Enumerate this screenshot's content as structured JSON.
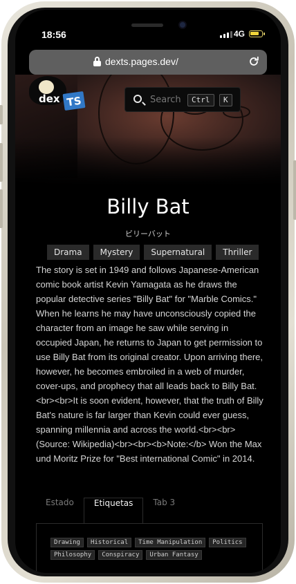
{
  "status_bar": {
    "time": "18:56",
    "network": "4G"
  },
  "browser": {
    "url": "dexts.pages.dev/"
  },
  "site": {
    "logo_text": "dex",
    "logo_badge": "TS",
    "search": {
      "placeholder": "Search",
      "shortcut_ctrl": "Ctrl",
      "shortcut_key": "K"
    }
  },
  "title": {
    "name": "Billy Bat",
    "native_name": "ビリーバット",
    "genres": [
      "Drama",
      "Mystery",
      "Supernatural",
      "Thriller"
    ],
    "description": "The story is set in 1949 and follows Japanese-American comic book artist Kevin Yamagata as he draws the popular detective series \"Billy Bat\" for \"Marble Comics.\" When he learns he may have unconsciously copied the character from an image he saw while serving in occupied Japan, he returns to Japan to get permission to use Billy Bat from its original creator. Upon arriving there, however, he becomes embroiled in a web of murder, cover-ups, and prophecy that all leads back to Billy Bat.<br><br>It is soon evident, however, that the truth of Billy Bat's nature is far larger than Kevin could ever guess, spanning millennia and across the world.<br><br> (Source: Wikipedia)<br><br><b>Note:</b> Won the Max und Moritz Prize for \"Best international Comic\" in 2014."
  },
  "tabs": [
    {
      "label": "Estado",
      "active": false
    },
    {
      "label": "Etiquetas",
      "active": true
    },
    {
      "label": "Tab 3",
      "active": false
    }
  ],
  "tags": [
    "Drawing",
    "Historical",
    "Time Manipulation",
    "Politics",
    "Philosophy",
    "Conspiracy",
    "Urban Fantasy"
  ],
  "colors": {
    "background": "#000000",
    "genre_chip": "#2a2a2a",
    "logo_badge": "#3178c6",
    "url_bar": "#5f5f5f"
  }
}
